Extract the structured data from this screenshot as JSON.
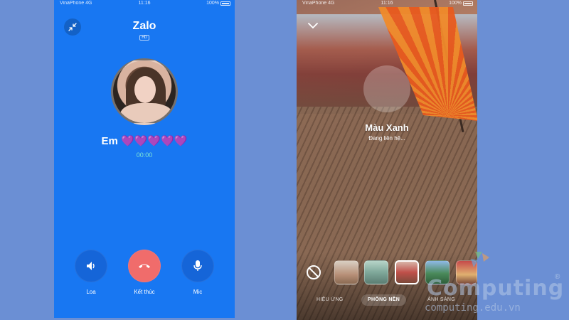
{
  "left_phone": {
    "status_bar": {
      "carrier": "VinaPhone 4G",
      "time": "11:16",
      "battery": "100%"
    },
    "app_title": "Zalo",
    "hd_badge": "HD",
    "caller_name": "Em 💜💜💜💜💜",
    "timer": "00:00",
    "controls": [
      {
        "label": "Loa",
        "icon": "speaker-icon"
      },
      {
        "label": "Kết thúc",
        "icon": "hang-up-icon"
      },
      {
        "label": "Mic",
        "icon": "microphone-icon"
      }
    ],
    "colors": {
      "background": "#1877f2",
      "hang_up": "#f06c6b",
      "timer": "#7fe7d4"
    }
  },
  "right_phone": {
    "status_bar": {
      "carrier": "VinaPhone 4G",
      "time": "11:16",
      "battery": "100%"
    },
    "caller_name": "Màu Xanh",
    "call_status": "Đang liên hệ...",
    "tabs": [
      {
        "label": "HIỆU ỨNG",
        "active": false
      },
      {
        "label": "PHÔNG NỀN",
        "active": true
      },
      {
        "label": "ÁNH SÁNG",
        "active": false
      }
    ],
    "backgrounds": [
      "room",
      "hallway",
      "amusement-park",
      "lake",
      "street"
    ],
    "selected_background": "amusement-park"
  },
  "watermark": {
    "brand": "Computing",
    "url": "computing.edu.vn",
    "reg": "®"
  }
}
